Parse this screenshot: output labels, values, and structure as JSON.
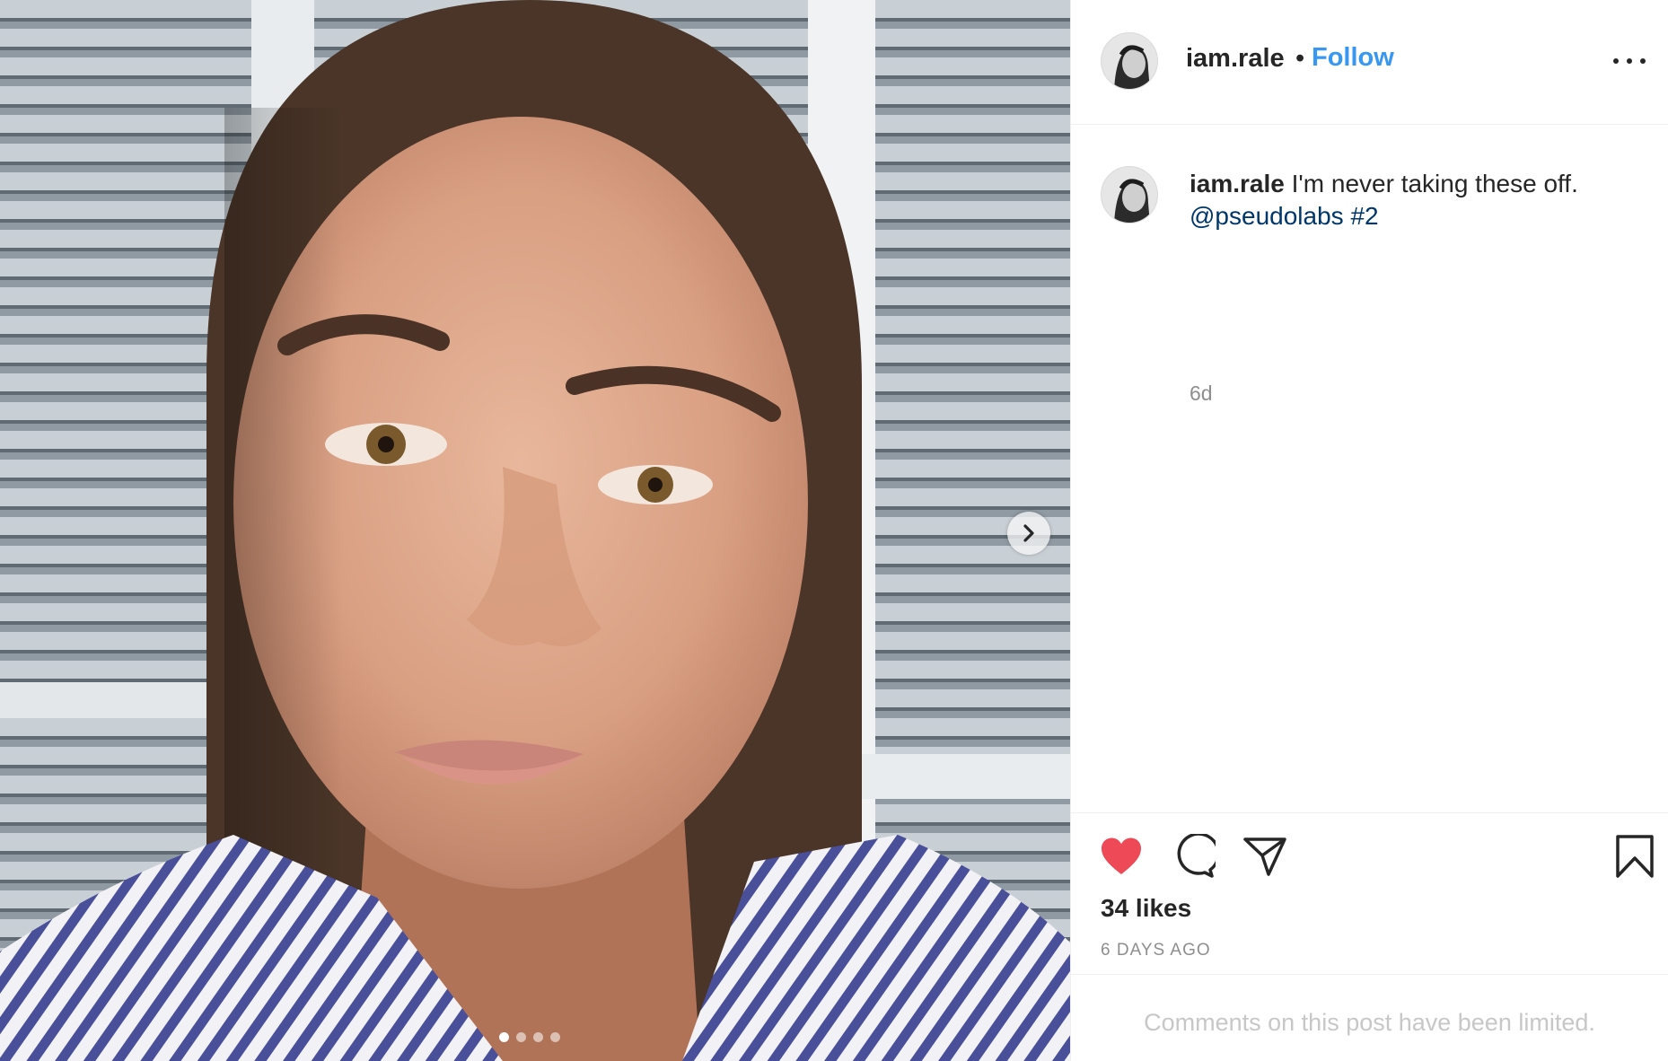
{
  "post": {
    "username": "iam.rale",
    "follow_label": "Follow",
    "separator": "•",
    "caption": {
      "username": "iam.rale",
      "text": "I'm never taking these off.",
      "mention": "@pseudolabs",
      "hashtag": "#2"
    },
    "relative_time": "6d",
    "likes": "34 likes",
    "posted_ago": "6 DAYS AGO",
    "comments_notice": "Comments on this post have been limited.",
    "carousel": {
      "slide_count": 4,
      "active_slide": 1
    }
  },
  "icons": {
    "more": "more-options-icon",
    "next": "chevron-right-icon",
    "like": "heart-filled-icon",
    "comment": "comment-bubble-icon",
    "share": "paper-plane-icon",
    "save": "bookmark-icon"
  },
  "colors": {
    "follow_blue": "#3897f0",
    "heart_red": "#ed4956",
    "link_navy": "#00376b",
    "muted_gray": "#8e8e8e"
  }
}
